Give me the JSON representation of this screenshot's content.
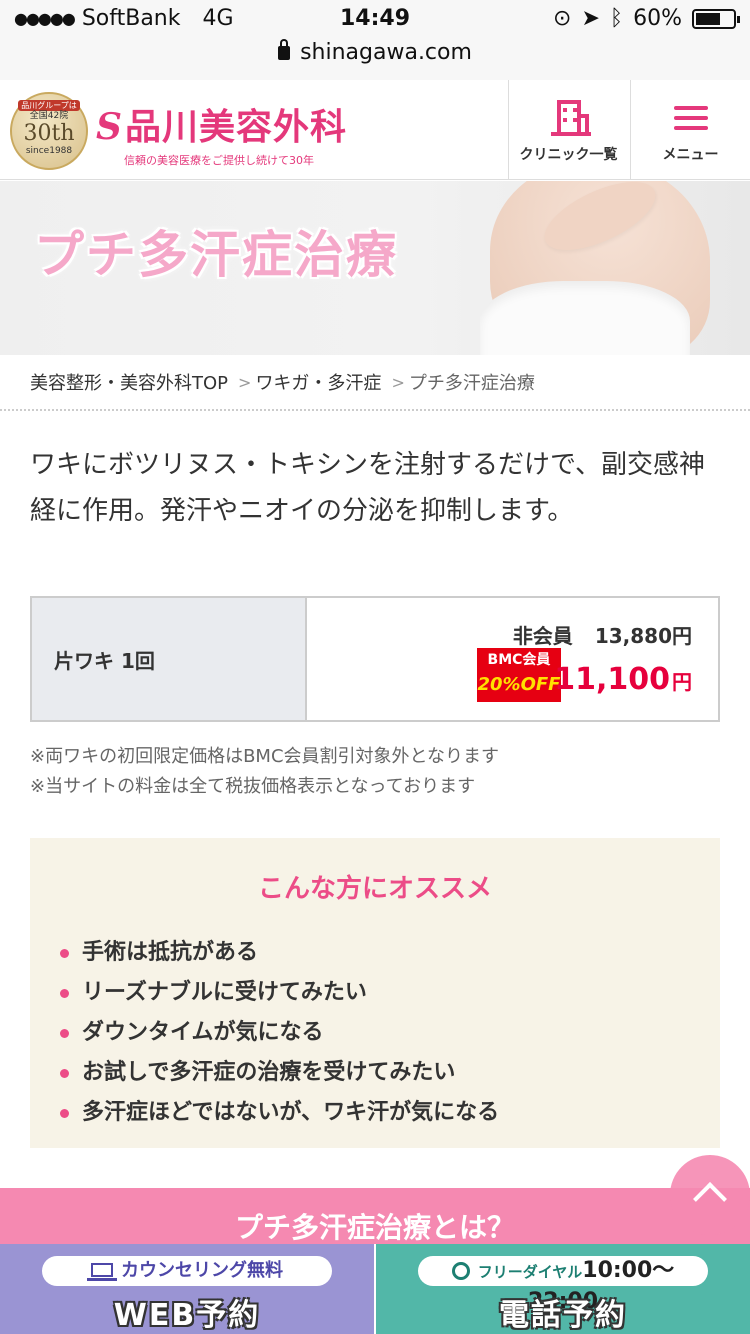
{
  "status_bar": {
    "signal": "●●●●●",
    "carrier": "SoftBank",
    "network": "4G",
    "time": "14:49",
    "battery": "60%"
  },
  "browser": {
    "url": "shinagawa.com"
  },
  "header": {
    "badge": {
      "line1": "品川グループは",
      "line2": "全国42院",
      "line3": "30th",
      "line4": "since1988"
    },
    "brand_mark": "S",
    "brand_name": "品川美容外科",
    "tagline": "信頼の美容医療をご提供し続けて30年",
    "clinic_label": "クリニック一覧",
    "menu_label": "メニュー"
  },
  "hero": {
    "title": "プチ多汗症治療"
  },
  "breadcrumb": {
    "items": [
      "美容整形・美容外科TOP",
      "ワキガ・多汗症"
    ],
    "separator": ">",
    "current": "プチ多汗症治療"
  },
  "intro": "ワキにボツリヌス・トキシンを注射するだけで、副交感神経に作用。発汗やニオイの分泌を抑制します。",
  "price": {
    "item": "片ワキ 1回",
    "nonmember_label": "非会員",
    "nonmember_price": "13,880円",
    "bmc_label": "BMC会員",
    "bmc_discount": "20%OFF",
    "member_price": "11,100",
    "member_unit": "円"
  },
  "notes": [
    "※両ワキの初回限定価格はBMC会員割引対象外となります",
    "※当サイトの料金は全て税抜価格表示となっております"
  ],
  "recommend": {
    "title": "こんな方にオススメ",
    "items": [
      "手術は抵抗がある",
      "リーズナブルに受けてみたい",
      "ダウンタイムが気になる",
      "お試しで多汗症の治療を受けてみたい",
      "多汗症ほどではないが、ワキ汗が気になる"
    ]
  },
  "section_title": "プチ多汗症治療とは？",
  "bottom_bar": {
    "web_pill": "カウンセリング無料",
    "web_main": "WEB予約",
    "tel_pill_label": "フリーダイヤル",
    "tel_hours": "10:00〜22:00",
    "tel_main": "電話予約"
  },
  "colors": {
    "accent": "#e4387b",
    "section": "#f589b1",
    "web": "#9a94d3",
    "tel": "#52b7a8"
  }
}
